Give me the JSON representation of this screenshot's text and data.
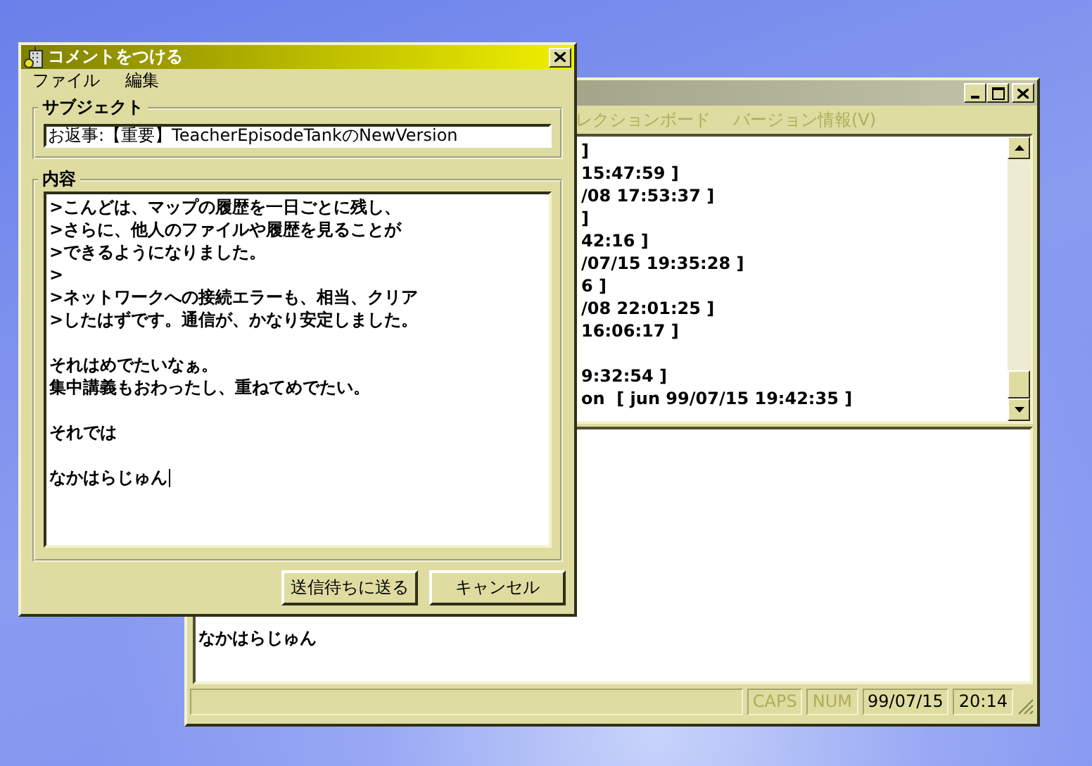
{
  "main_window": {
    "active": false,
    "menu": [
      {
        "label": "レクションボード",
        "disabled": true
      },
      {
        "label": "バージョン情報(V)",
        "disabled": true
      }
    ],
    "log_lines": [
      {
        "kind": "text",
        "text": "]"
      },
      {
        "kind": "text",
        "text": "15:47:59 ]"
      },
      {
        "kind": "text",
        "text": "/08 17:53:37 ]"
      },
      {
        "kind": "text",
        "text": "]"
      },
      {
        "kind": "text",
        "text": "42:16 ]"
      },
      {
        "kind": "text",
        "text": "/07/15 19:35:28 ]"
      },
      {
        "kind": "text",
        "text": "6 ]"
      },
      {
        "kind": "text",
        "text": "/08 22:01:25 ]"
      },
      {
        "kind": "text",
        "text": "16:06:17 ]"
      },
      {
        "kind": "blank"
      },
      {
        "kind": "text",
        "text": "9:32:54 ]"
      },
      {
        "kind": "text",
        "text": "on  [ jun 99/07/15 19:42:35 ]"
      }
    ],
    "preview_text": "なかはらじゅん",
    "status_bar": [
      {
        "kind": "blank"
      },
      {
        "kind": "indicator",
        "text": "CAPS",
        "on": false
      },
      {
        "kind": "indicator",
        "text": "NUM",
        "on": false
      },
      {
        "kind": "text",
        "text": "99/07/15"
      },
      {
        "kind": "text",
        "text": "20:14"
      }
    ]
  },
  "dialog": {
    "title": "コメントをつける",
    "active": true,
    "menu": [
      {
        "label": "ファイル"
      },
      {
        "label": "編集"
      }
    ],
    "subject": {
      "label": "サブジェクト",
      "value": "お返事:【重要】TeacherEpisodeTankのNewVersion"
    },
    "content": {
      "label": "内容",
      "paragraphs": [
        [
          ">こんどは、マップの履歴を一日ごとに残し、",
          ">さらに、他人のファイルや履歴を見ることが",
          ">できるようになりました。",
          ">",
          ">ネットワークへの接続エラーも、相当、クリア",
          ">したはずです。通信が、かなり安定しました。"
        ],
        [
          "それはめでたいなぁ。",
          "集中講義もおわったし、重ねてめでたい。"
        ],
        [
          "それでは"
        ],
        [
          "なかはらじゅん"
        ]
      ]
    },
    "buttons": [
      "送信待ちに送る",
      "キャンセル"
    ]
  }
}
